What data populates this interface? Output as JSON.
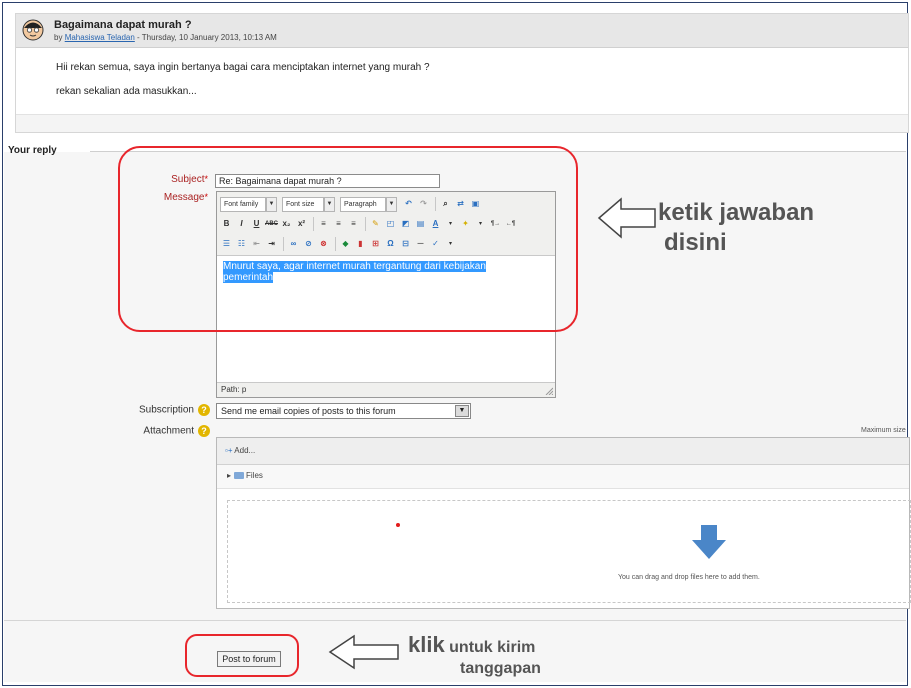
{
  "post": {
    "title": "Bagaimana dapat murah ?",
    "by": "by",
    "author": "Mahasiswa Teladan",
    "date": "- Thursday, 10 January 2013, 10:13 AM",
    "line1": "Hii rekan semua, saya ingin bertanya bagai cara menciptakan internet yang murah ?",
    "line2": "rekan sekalian ada masukkan..."
  },
  "reply": {
    "legend": "Your reply",
    "subject_label": "Subject",
    "subject_value": "Re: Bagaimana dapat murah ?",
    "message_label": "Message",
    "required_mark": "*",
    "toolbar": {
      "font_family": "Font family",
      "font_size": "Font size",
      "paragraph": "Paragraph"
    },
    "message_line1": "Mnurut saya, agar internet murah tergantung dari kebijakan",
    "message_line2": "pemerintah",
    "path": "Path: p",
    "subscription_label": "Subscription",
    "subscription_value": "Send me email copies of posts to this forum",
    "attachment_label": "Attachment",
    "max_size": "Maximum size",
    "add_label": "Add...",
    "files_label": "Files",
    "drop_text": "You can drag and drop files here to add them.",
    "post_button": "Post to forum"
  },
  "annotations": {
    "message_hint_1": "ketik jawaban",
    "message_hint_2": "disini",
    "submit_hint_bold": "klik",
    "submit_hint_rest": "untuk kirim",
    "submit_hint_line2": "tanggapan",
    "color": "#e8262c"
  },
  "icons": [
    "avatar-icon",
    "help-icon",
    "add-file-icon",
    "folder-icon",
    "download-arrow-icon",
    "hollow-arrow-icon"
  ]
}
